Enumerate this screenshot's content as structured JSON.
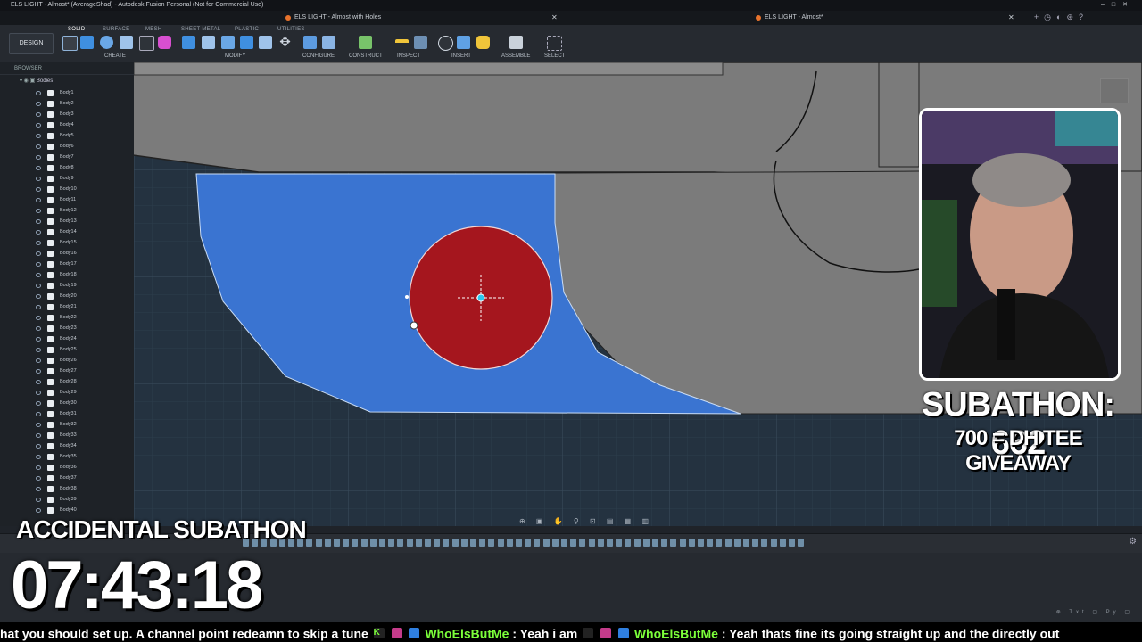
{
  "window": {
    "title": "ELS LIGHT - Almost* (AverageShad) - Autodesk Fusion Personal (Not for Commercial Use)"
  },
  "tabs": [
    {
      "label": "ELS LIGHT - Almost with Holes"
    },
    {
      "label": "ELS LIGHT - Almost*"
    }
  ],
  "toolbar": {
    "design_label": "DESIGN",
    "workspace_tabs": [
      "SOLID",
      "SURFACE",
      "MESH",
      "SHEET METAL",
      "PLASTIC",
      "UTILITIES"
    ],
    "groups": [
      "CREATE",
      "MODIFY",
      "CONFIGURE",
      "CONSTRUCT",
      "INSPECT",
      "INSERT",
      "ASSEMBLE",
      "SELECT"
    ]
  },
  "browser": {
    "header": "BROWSER",
    "folder_label": "Bodies",
    "bodies": [
      "Body1",
      "Body2",
      "Body3",
      "Body4",
      "Body5",
      "Body6",
      "Body7",
      "Body8",
      "Body9",
      "Body10",
      "Body11",
      "Body12",
      "Body13",
      "Body14",
      "Body15",
      "Body16",
      "Body17",
      "Body18",
      "Body19",
      "Body20",
      "Body21",
      "Body22",
      "Body23",
      "Body24",
      "Body25",
      "Body26",
      "Body27",
      "Body28",
      "Body29",
      "Body30",
      "Body31",
      "Body32",
      "Body33",
      "Body34",
      "Body35",
      "Body36",
      "Body37",
      "Body38",
      "Body39",
      "Body40"
    ]
  },
  "overlay": {
    "subathon_count": "SUBATHON: 662",
    "giveaway": "700 = DH TEE GIVEAWAY",
    "accidental": "ACCIDENTAL SUBATHON",
    "timer": "07:43:18"
  },
  "ticker": {
    "text1": "hat you should set up. A channel point redeamn to skip a tune",
    "user1": "WhoElsButMe",
    "msg1": ": Yeah i am",
    "user2": "WhoElsButMe",
    "msg2": ": Yeah thats fine its going straight up and the directly out"
  },
  "colors": {
    "sketch_blue": "#3a74d1",
    "hole_red": "#a5161e",
    "grid_bg": "#243240",
    "gray_body": "#7b7b7b"
  }
}
